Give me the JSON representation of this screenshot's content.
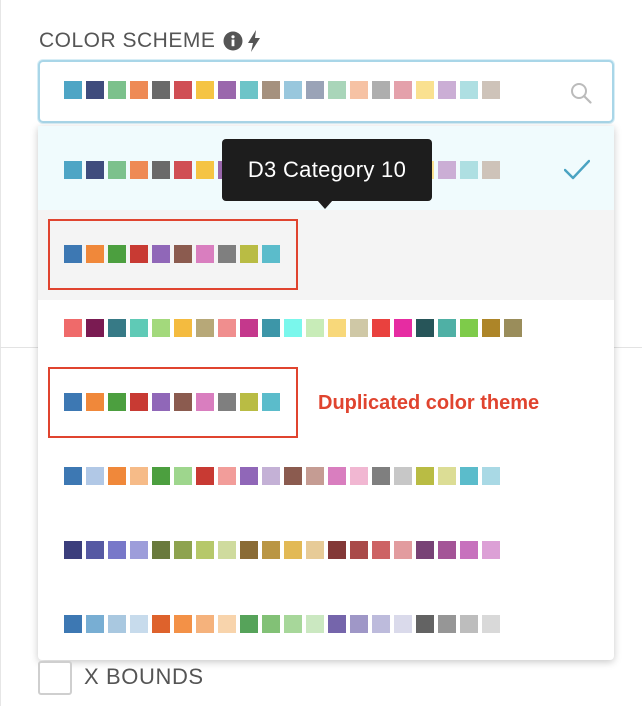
{
  "field": {
    "label": "COLOR SCHEME",
    "info_icon": "info-icon",
    "bolt_icon": "lightning-icon",
    "search_icon": "search-icon",
    "selected_scheme": [
      "#4ea5c5",
      "#3f4c7d",
      "#7cc18c",
      "#ee8a55",
      "#6a6a6a",
      "#d04e54",
      "#f5c444",
      "#9a67ac",
      "#6dc4c8",
      "#a5917e",
      "#99c7dd",
      "#9aa3b7",
      "#a9d5b9",
      "#f6c2a4",
      "#aeaeae",
      "#e4a1ab",
      "#fae190",
      "#cbaed5",
      "#aedfe2",
      "#cec3b9"
    ]
  },
  "tooltip": {
    "text": "D3 Category 10"
  },
  "annotation": {
    "text": "Duplicated color theme",
    "color": "#e0442f"
  },
  "options": [
    {
      "state": "selected",
      "colors": [
        "#4ea5c5",
        "#3f4c7d",
        "#7cc18c",
        "#ee8a55",
        "#6a6a6a",
        "#d04e54",
        "#f5c444",
        "#9a67ac",
        "#6dc4c8",
        "#a5917e",
        "#99c7dd",
        "#9aa3b7",
        "#a9d5b9",
        "#f6c2a4",
        "#aeaeae",
        "#e4a1ab",
        "#fae190",
        "#cbaed5",
        "#aedfe2",
        "#cec3b9"
      ]
    },
    {
      "state": "hovered",
      "colors": [
        "#3d78b3",
        "#f0883a",
        "#4c9f3f",
        "#c83a33",
        "#9067b8",
        "#8b5b4f",
        "#d97ebf",
        "#7f7f7f",
        "#b9bc44",
        "#5bbccb"
      ]
    },
    {
      "state": "normal",
      "colors": [
        "#ef6a6a",
        "#7a1b52",
        "#377a86",
        "#5fcab6",
        "#a3d97c",
        "#f4bb3f",
        "#b7a878",
        "#f08e8e",
        "#c4388c",
        "#3d96a8",
        "#7af7ec",
        "#c8ecb8",
        "#f8d87a",
        "#cfc8a6",
        "#e9413e",
        "#e62ca2",
        "#275559",
        "#4fb0a5",
        "#7ecb4a",
        "#ad8528",
        "#9a8d5b"
      ]
    },
    {
      "state": "normal",
      "colors": [
        "#3d78b3",
        "#f0883a",
        "#4c9f3f",
        "#c83a33",
        "#9067b8",
        "#8b5b4f",
        "#d97ebf",
        "#7f7f7f",
        "#b9bc44",
        "#5bbccb"
      ]
    },
    {
      "state": "normal",
      "colors": [
        "#3d78b3",
        "#b1c8e6",
        "#f0883a",
        "#f6bb88",
        "#4c9f3f",
        "#9ed68d",
        "#c83a33",
        "#f29d9a",
        "#9067b8",
        "#c4b1d6",
        "#8b5b4f",
        "#c59c93",
        "#d97ebf",
        "#f1b7d2",
        "#7f7f7f",
        "#c7c7c7",
        "#b9bc44",
        "#dcdd95",
        "#5bbccb",
        "#a9d9e5"
      ]
    },
    {
      "state": "normal",
      "colors": [
        "#3b3e7c",
        "#5659a3",
        "#7878c9",
        "#9d9dda",
        "#6a7a3d",
        "#8ea34f",
        "#b6c86a",
        "#cfdb9e",
        "#8a6b35",
        "#ba9644",
        "#e2b955",
        "#e7cb97",
        "#833837",
        "#a94a49",
        "#cd6364",
        "#e29c9f",
        "#784276",
        "#a45497",
        "#c771bd",
        "#dca0d6"
      ]
    },
    {
      "state": "normal",
      "colors": [
        "#3d78b3",
        "#78aed3",
        "#a9c8e0",
        "#c7dbec",
        "#de622c",
        "#f39147",
        "#f5b27c",
        "#f8d4ac",
        "#56a35a",
        "#82c176",
        "#a7d79a",
        "#cbe8c1",
        "#7565ab",
        "#9f97c7",
        "#bdbbdc",
        "#dadaeb",
        "#636363",
        "#969696",
        "#bdbdbd",
        "#d9d9d9"
      ]
    }
  ],
  "xbounds": {
    "label": "X BOUNDS"
  }
}
